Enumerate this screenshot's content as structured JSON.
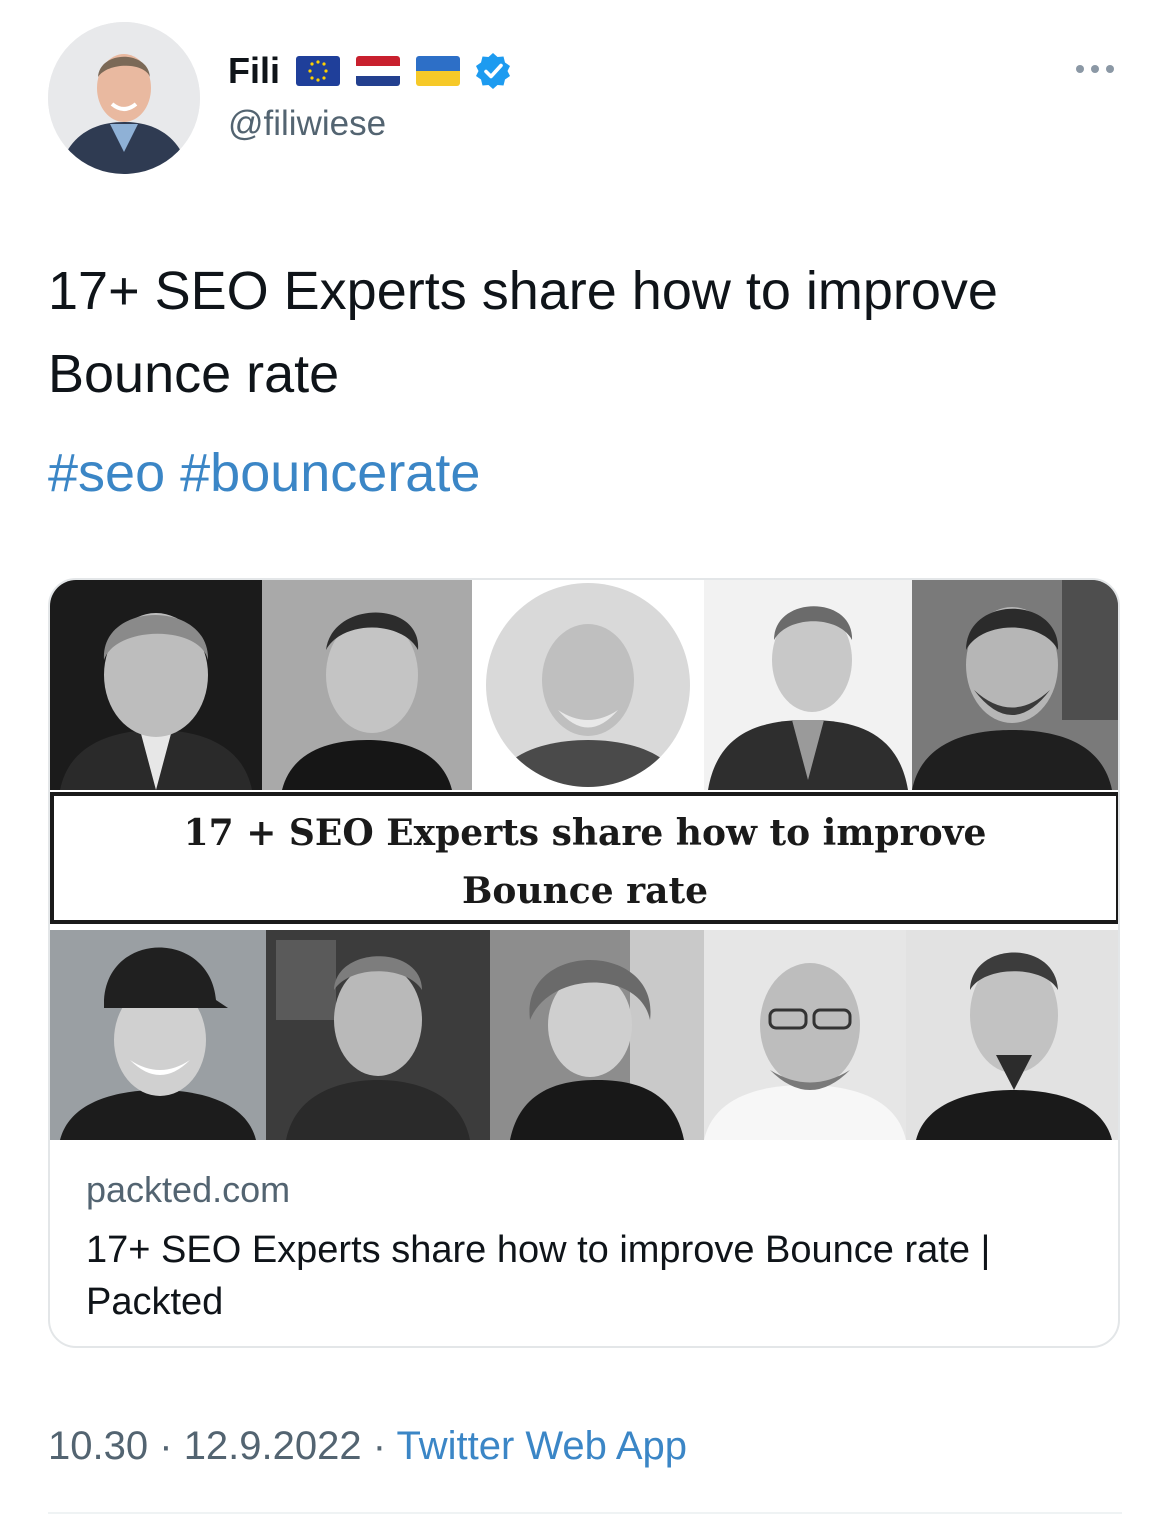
{
  "author": {
    "display_name": "Fili",
    "handle": "@filiwiese",
    "flags": [
      "eu-flag-icon",
      "netherlands-flag-icon",
      "ukraine-flag-icon"
    ],
    "verified": true
  },
  "tweet": {
    "text": "17+ SEO Experts share how to improve Bounce rate",
    "hashtags": [
      "#seo",
      "#bouncerate"
    ]
  },
  "card": {
    "image_heading_line1": "17 + SEO Experts share how to improve",
    "image_heading_line2": "Bounce rate",
    "domain": "packted.com",
    "title": "17+ SEO Experts share how to improve Bounce rate | Packted"
  },
  "meta": {
    "time": "10.30",
    "date": "12.9.2022",
    "separator": "·",
    "source": "Twitter Web App"
  },
  "colors": {
    "link": "#3b86c6",
    "verified": "#1d9bf0",
    "muted": "#536471"
  }
}
